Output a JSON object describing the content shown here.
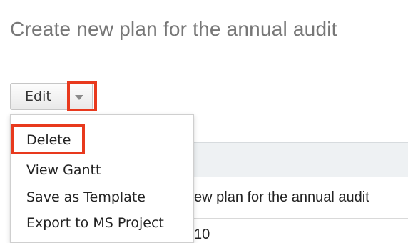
{
  "page": {
    "title": "Create new plan for the annual audit"
  },
  "toolbar": {
    "edit_label": "Edit",
    "dropdown_icon": "chevron-down-icon"
  },
  "action_menu": {
    "items": [
      {
        "label": "Delete"
      },
      {
        "label": "View Gantt"
      },
      {
        "label": "Save as Template"
      },
      {
        "label": "Export to MS Project"
      }
    ]
  },
  "record_table": {
    "name_value": "ew plan for the annual audit",
    "partial_value": "10"
  },
  "colors": {
    "highlight": "#e8391d",
    "title_text": "#777777",
    "header_background": "#eef1f3"
  }
}
